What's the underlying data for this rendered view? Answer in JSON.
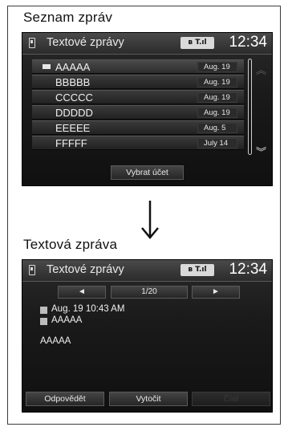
{
  "list_caption": "Seznam zpráv",
  "detail_caption": "Textová zpráva",
  "status": {
    "title": "Textové zprávy",
    "indicators": "ʙ T.ıl",
    "clock": "12:34"
  },
  "messages": [
    {
      "name": "AAAAA",
      "date": "Aug. 19"
    },
    {
      "name": "BBBBB",
      "date": "Aug. 19"
    },
    {
      "name": "CCCCC",
      "date": "Aug. 19"
    },
    {
      "name": "DDDDD",
      "date": "Aug. 19"
    },
    {
      "name": "EEEEE",
      "date": "Aug. 5"
    },
    {
      "name": "FFFFF",
      "date": "July 14"
    }
  ],
  "list_buttons": {
    "select_account": "Vybrat účet"
  },
  "detail": {
    "prev": "◄",
    "page": "1/20",
    "next": "►",
    "datetime": "Aug. 19 10:43 AM",
    "sender": "AAAAA",
    "body": "AAAAA",
    "reply": "Odpovědět",
    "call": "Vytočit",
    "read": "Číst"
  },
  "icons": {
    "phone": "phone-icon",
    "envelope": "envelope-icon",
    "scroll_up": "chevron-double-up-icon",
    "scroll_down": "chevron-double-down-icon",
    "arrow": "arrow-down-icon"
  }
}
